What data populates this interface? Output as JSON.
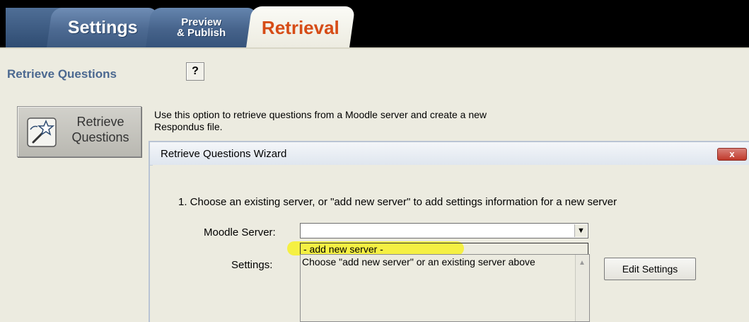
{
  "tabs": {
    "settings": "Settings",
    "preview_line1": "Preview",
    "preview_line2": "& Publish",
    "retrieval": "Retrieval"
  },
  "header": {
    "title": "Retrieve Questions",
    "help_label": "?"
  },
  "retrieve_button": {
    "line1": "Retrieve",
    "line2": "Questions"
  },
  "description": {
    "line1": "Use this option to retrieve questions from a Moodle server and create a new",
    "line2": "Respondus file."
  },
  "dialog": {
    "title": "Retrieve Questions Wizard",
    "close_label": "x",
    "step1": "1.  Choose an existing server, or \"add new server\" to add settings information for a new server",
    "server_label": "Moodle Server:",
    "server_value": "",
    "dropdown_items": [
      "- add new server -"
    ],
    "settings_label": "Settings:",
    "settings_text": "Choose \"add new server\" or an existing server above",
    "edit_button": "Edit Settings"
  },
  "colors": {
    "accent_orange": "#d64c16",
    "tab_blue": "#4d6a92",
    "highlight_yellow": "#f5f03a",
    "panel_beige": "#ecebe0"
  }
}
